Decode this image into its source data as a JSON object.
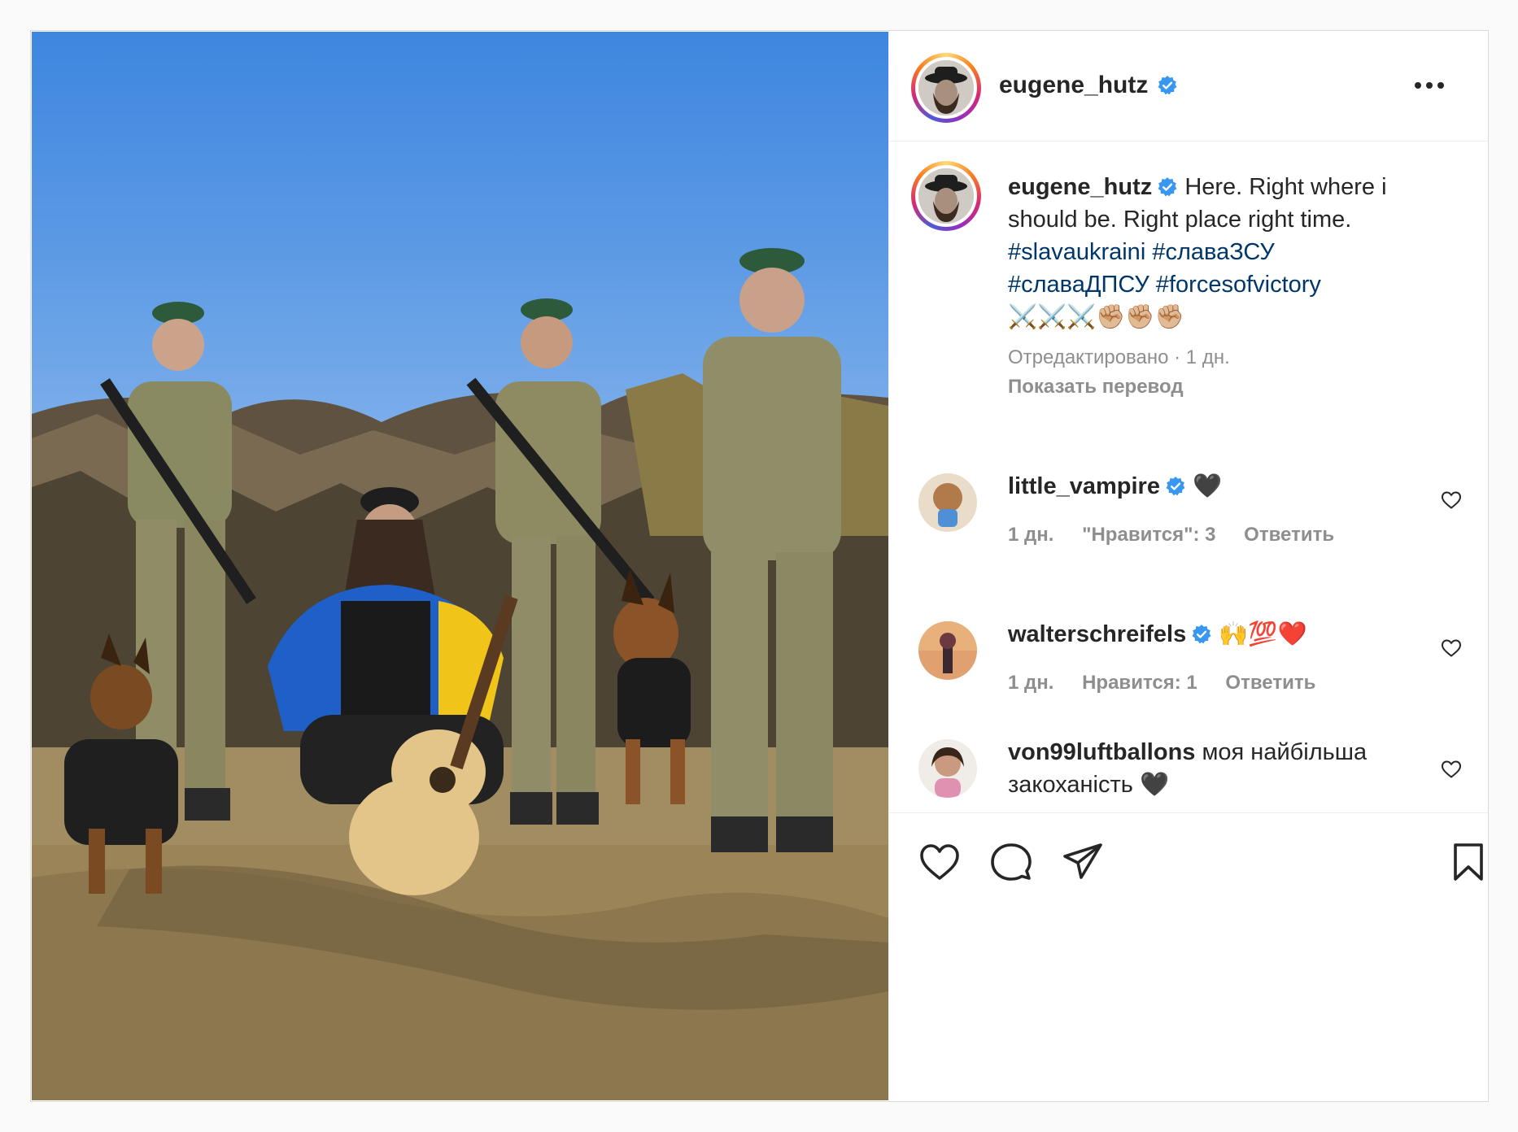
{
  "post": {
    "author": "eugene_hutz",
    "author_verified": true
  },
  "caption": {
    "username": "eugene_hutz",
    "text_line1": "Here. Right where i",
    "text_line2": "should be. Right place right time.",
    "hashtags": [
      "#slavaukraini",
      "#славаЗСУ",
      "#славаДПСУ",
      "#forcesofvictory"
    ],
    "emoji": "⚔️⚔️⚔️✊🏼✊🏼✊🏼",
    "edited": "Отредактировано · 1 дн.",
    "translate": "Показать перевод"
  },
  "comments": [
    {
      "username": "little_vampire",
      "verified": true,
      "text": "🖤",
      "age": "1 дн.",
      "likes": "\"Нравится\": 3",
      "reply": "Ответить"
    },
    {
      "username": "walterschreifels",
      "verified": true,
      "text": "🙌💯❤️",
      "age": "1 дн.",
      "likes": "Нравится: 1",
      "reply": "Ответить"
    },
    {
      "username": "von99luftballons",
      "verified": false,
      "text_line1": "моя найбільша",
      "text_line2": "закоханість 🖤"
    }
  ],
  "icons": {
    "like": "heart-icon",
    "comment": "comment-icon",
    "share": "share-icon",
    "save": "bookmark-icon",
    "more": "more-horizontal-icon",
    "verified": "verified-badge-icon"
  },
  "colors": {
    "verified": "#3897f0",
    "hashtag": "#00376b",
    "meta": "#8e8e8e"
  }
}
